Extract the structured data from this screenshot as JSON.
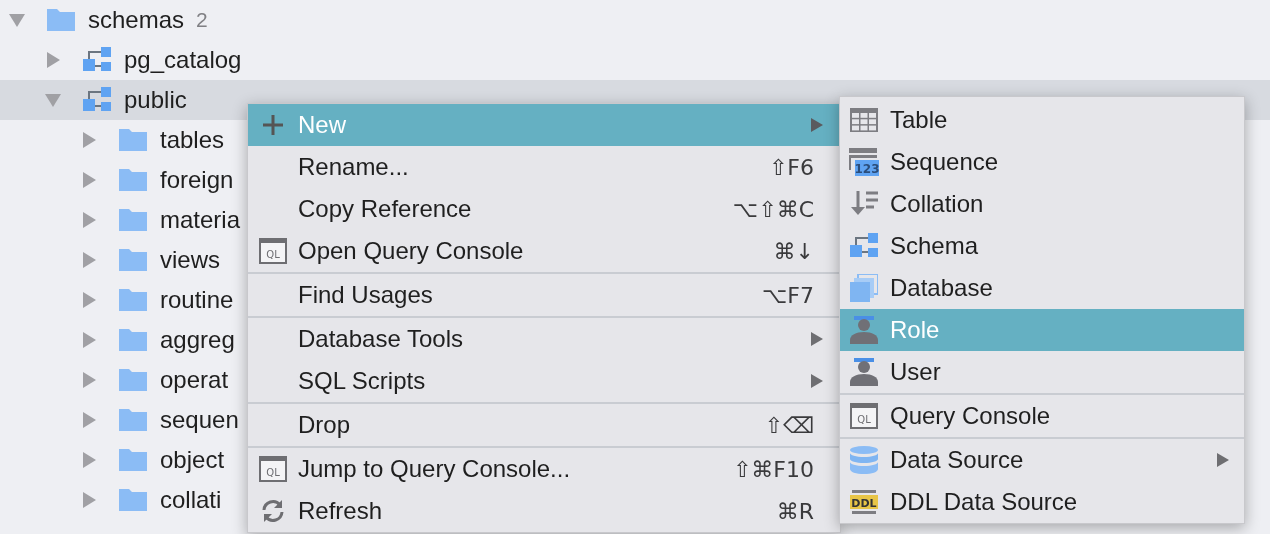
{
  "tree": [
    {
      "label": "schemas",
      "count": "2",
      "kind": "folder",
      "expanded": true,
      "selected": false,
      "children": [
        {
          "label": "pg_catalog",
          "kind": "schema",
          "expanded": false,
          "selected": false
        },
        {
          "label": "public",
          "kind": "schema",
          "expanded": true,
          "selected": true,
          "children": [
            {
              "label": "tables",
              "kind": "folder",
              "expanded": false,
              "selected": false
            },
            {
              "label": "foreign",
              "kind": "folder",
              "expanded": false,
              "selected": false
            },
            {
              "label": "materia",
              "kind": "folder",
              "expanded": false,
              "selected": false
            },
            {
              "label": "views",
              "kind": "folder",
              "expanded": false,
              "selected": false
            },
            {
              "label": "routine",
              "kind": "folder",
              "expanded": false,
              "selected": false
            },
            {
              "label": "aggreg",
              "kind": "folder",
              "expanded": false,
              "selected": false
            },
            {
              "label": "operat",
              "kind": "folder",
              "expanded": false,
              "selected": false
            },
            {
              "label": "sequen",
              "kind": "folder",
              "expanded": false,
              "selected": false
            },
            {
              "label": "object",
              "kind": "folder",
              "expanded": false,
              "selected": false
            },
            {
              "label": "collati",
              "kind": "folder",
              "expanded": false,
              "selected": false
            }
          ]
        }
      ]
    }
  ],
  "context_menu": {
    "groups": [
      [
        {
          "label": "New",
          "kind": "add",
          "submenu": true,
          "selected": true
        },
        {
          "label": "Rename...",
          "kind": "plain",
          "shortcut": "⇧F6",
          "submenu": false,
          "selected": false
        },
        {
          "label": "Copy Reference",
          "kind": "plain",
          "shortcut": "⌥⇧⌘C",
          "submenu": false,
          "selected": false
        },
        {
          "label": "Open Query Console",
          "kind": "console",
          "badge": "QL",
          "shortcut": "⌘↓",
          "submenu": false,
          "selected": false
        }
      ],
      [
        {
          "label": "Find Usages",
          "kind": "plain",
          "shortcut": "⌥F7",
          "submenu": false,
          "selected": false
        }
      ],
      [
        {
          "label": "Database Tools",
          "kind": "plain",
          "submenu": true,
          "selected": false
        },
        {
          "label": "SQL Scripts",
          "kind": "plain",
          "submenu": true,
          "selected": false
        }
      ],
      [
        {
          "label": "Drop",
          "kind": "plain",
          "shortcut": "⇧⌫",
          "submenu": false,
          "selected": false
        }
      ],
      [
        {
          "label": "Jump to Query Console...",
          "kind": "console",
          "badge": "QL",
          "shortcut": "⇧⌘F10",
          "submenu": false,
          "selected": false
        },
        {
          "label": "Refresh",
          "kind": "refresh",
          "shortcut": "⌘R",
          "submenu": false,
          "selected": false
        }
      ]
    ]
  },
  "submenu": {
    "groups": [
      [
        {
          "label": "Table",
          "kind": "table",
          "submenu": false,
          "selected": false
        },
        {
          "label": "Sequence",
          "kind": "sequence",
          "badge": "123",
          "submenu": false,
          "selected": false
        },
        {
          "label": "Collation",
          "kind": "collation",
          "submenu": false,
          "selected": false
        },
        {
          "label": "Schema",
          "kind": "schema",
          "submenu": false,
          "selected": false
        },
        {
          "label": "Database",
          "kind": "database",
          "submenu": false,
          "selected": false
        },
        {
          "label": "Role",
          "kind": "person",
          "submenu": false,
          "selected": true
        },
        {
          "label": "User",
          "kind": "person",
          "submenu": false,
          "selected": false
        }
      ],
      [
        {
          "label": "Query Console",
          "kind": "console",
          "badge": "QL",
          "submenu": false,
          "selected": false
        }
      ],
      [
        {
          "label": "Data Source",
          "kind": "datasource",
          "submenu": true,
          "selected": false
        },
        {
          "label": "DDL Data Source",
          "kind": "ddl",
          "badge": "DDL",
          "submenu": false,
          "selected": false
        }
      ]
    ]
  }
}
